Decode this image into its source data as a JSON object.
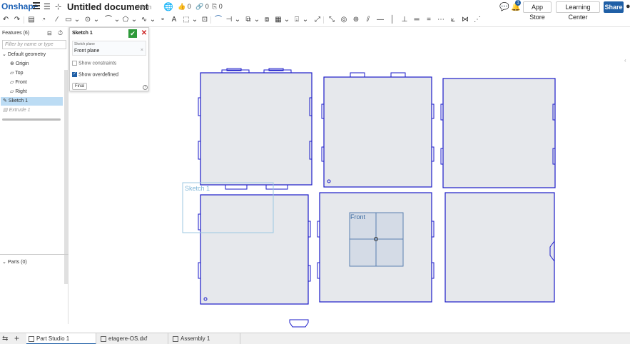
{
  "header": {
    "logo": "Onshape",
    "doc_title": "Untitled document",
    "branch": "Main",
    "likes": "0",
    "links": "0",
    "copies": "0",
    "notifications": "1",
    "app_store": "App Store",
    "learning_center": "Learning Center",
    "share": "Share"
  },
  "features": {
    "title": "Features (6)",
    "filter_placeholder": "Filter by name or type",
    "items": [
      {
        "label": "Default geometry"
      },
      {
        "label": "Origin"
      },
      {
        "label": "Top"
      },
      {
        "label": "Front"
      },
      {
        "label": "Right"
      },
      {
        "label": "Sketch 1"
      },
      {
        "label": "Extrude 1"
      }
    ],
    "parts": "Parts (0)"
  },
  "dialog": {
    "title": "Sketch 1",
    "plane_label": "Sketch plane",
    "plane_value": "Front plane",
    "show_constraints": "Show constraints",
    "show_overdefined": "Show overdefined",
    "final": "Final"
  },
  "canvas": {
    "sketch_label": "Sketch 1",
    "plane_label": "Front"
  },
  "tabs": [
    {
      "label": "Part Studio 1"
    },
    {
      "label": "etagere-OS.dxf"
    },
    {
      "label": "Assembly 1"
    }
  ],
  "colors": {
    "accent": "#1f5fa6",
    "sketch_line": "#1a1ac8",
    "panel_fill": "#e6e8ec"
  }
}
